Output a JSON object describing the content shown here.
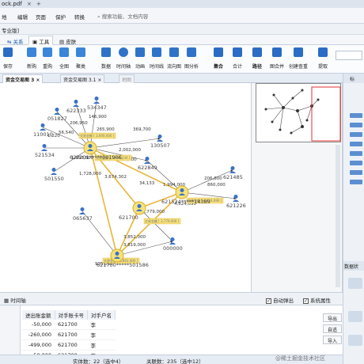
{
  "window": {
    "title": "ock.pdf"
  },
  "menu": {
    "items": [
      "地",
      "编辑",
      "页面",
      "保护",
      "转换"
    ],
    "search_placeholder": "搜索功能、文档内容"
  },
  "project": {
    "label": "专业版]"
  },
  "ribbon_tabs": [
    "关系",
    "工具",
    "皮肤"
  ],
  "toolbar": {
    "left": [
      "保存",
      "新购",
      "重购",
      "全图",
      "聚类"
    ],
    "mid": [
      "数据",
      "时间轴",
      "动画",
      "时间线",
      "流向图",
      "图分析"
    ],
    "right": [
      "集合",
      "合计",
      "路径",
      "图合并",
      "创建查重",
      "提取"
    ]
  },
  "doc_tabs": [
    "资金交易图 3",
    "资金交易图 3.1",
    "地图"
  ],
  "graph": {
    "nodes": [
      {
        "id": "534347",
        "label": "534347"
      },
      {
        "id": "622333",
        "label": "622333"
      },
      {
        "id": "051827",
        "label": "051827"
      },
      {
        "id": "110010",
        "label": "110010"
      },
      {
        "id": "521534",
        "label": "521534"
      },
      {
        "id": "501550",
        "label": "501550"
      },
      {
        "id": "065637",
        "label": "065637"
      },
      {
        "id": "130507",
        "label": "130507"
      },
      {
        "id": "622849",
        "label": "622849"
      },
      {
        "id": "621485",
        "label": "621485"
      },
      {
        "id": "621226",
        "label": "621226"
      },
      {
        "id": "000000",
        "label": "000000"
      },
      {
        "id": "hub1",
        "label": "622201*****001906"
      },
      {
        "id": "hub2",
        "label": "621700"
      },
      {
        "id": "hub3",
        "label": "621534*****14389"
      },
      {
        "id": "hub4",
        "label": "621700*****501586"
      }
    ],
    "edge_labels": [
      "146,900",
      "206,950",
      "56,540",
      "1,220",
      "2,002,000",
      "140,000",
      "1,993,800",
      "1,728,000",
      "3,674,302",
      "34,133",
      "1,994,000",
      "206,800",
      "860,000",
      "3,852,000",
      "3,819,000",
      "935,000",
      "265,900",
      "369,700",
      "4,624,690",
      "2,779,000"
    ],
    "badge_labels": [
      "交易金额 [ 2,600,000 ]",
      "交易金额 [ 5,993,234 ]",
      "交易金额 [ 2,779,000 ]",
      "交易金额 [ 4,624,690 ]",
      "交易金额 [ 3,802,900 ]"
    ]
  },
  "bottom": {
    "label": "时间轴",
    "checkbox_auto": "自动弹出",
    "checkbox_props": "系统属性"
  },
  "table": {
    "headers": [
      "进出账金额",
      "对手账卡号",
      "对手户名"
    ],
    "rows": [
      [
        "-50,000",
        "621700",
        "李"
      ],
      [
        "-260,000",
        "621700",
        "李"
      ],
      [
        "-499,000",
        "621700",
        "李"
      ],
      [
        "-50,000",
        "621700",
        "李"
      ]
    ],
    "buttons": [
      "导出",
      "自适",
      "导入"
    ]
  },
  "status": {
    "entity": "实体数：22（选中4）",
    "relation": "关联数：235（选中12）"
  },
  "right_panel": {
    "title": "标",
    "section": "数据状"
  },
  "watermark": "@稀土掘金技术社区"
}
